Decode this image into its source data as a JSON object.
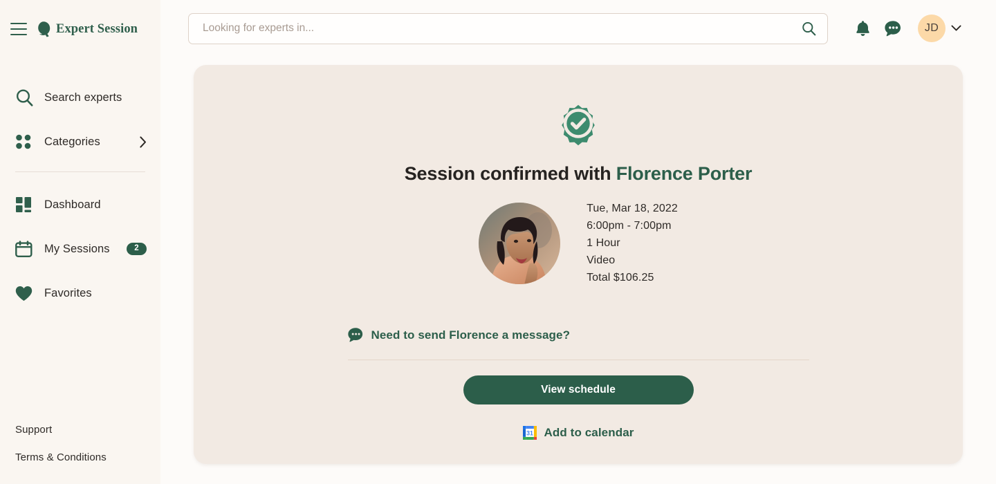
{
  "brand": {
    "name": "Expert Session",
    "logo_icon": "expert-session-q-mark",
    "menu_icon": "hamburger-menu-icon",
    "accent_green": "#2c5e4a",
    "avatar_peach": "#fcd9a8",
    "card_bg": "#f2eae3",
    "sidebar_bg": "#faf6f1",
    "page_bg": "#fdfbf9"
  },
  "sidebar": {
    "items": [
      {
        "label": "Search experts",
        "icon": "search-icon",
        "badge": null,
        "chevron": false
      },
      {
        "label": "Categories",
        "icon": "grid-dots-icon",
        "badge": null,
        "chevron": true
      },
      {
        "label": "Dashboard",
        "icon": "dashboard-icon",
        "badge": null,
        "chevron": false
      },
      {
        "label": "My Sessions",
        "icon": "calendar-icon",
        "badge": "2",
        "chevron": false
      },
      {
        "label": "Favorites",
        "icon": "heart-icon",
        "badge": null,
        "chevron": false
      }
    ],
    "footer_links": [
      {
        "label": "Support"
      },
      {
        "label": "Terms & Conditions"
      }
    ]
  },
  "topbar": {
    "search": {
      "placeholder": "Looking for experts in...",
      "value": "",
      "button_icon": "search-icon"
    },
    "notifications_icon": "bell-icon",
    "messages_icon": "chat-bubble-icon",
    "avatar_initials": "JD",
    "avatar_chevron_icon": "chevron-down-icon"
  },
  "card": {
    "status_icon": "verified-badge-check-icon",
    "title_prefix": "Session confirmed with ",
    "expert_name": "Florence Porter",
    "expert_photo_alt": "Florence Porter",
    "details": [
      "Tue, Mar 18, 2022",
      "6:00pm - 7:00pm",
      "1 Hour",
      "Video",
      "Total $106.25"
    ],
    "message_link": {
      "icon": "chat-bubble-icon",
      "label": "Need to send Florence a message?"
    },
    "primary_button": "View schedule",
    "calendar_link": {
      "icon": "google-calendar-icon",
      "label": "Add to calendar"
    }
  }
}
